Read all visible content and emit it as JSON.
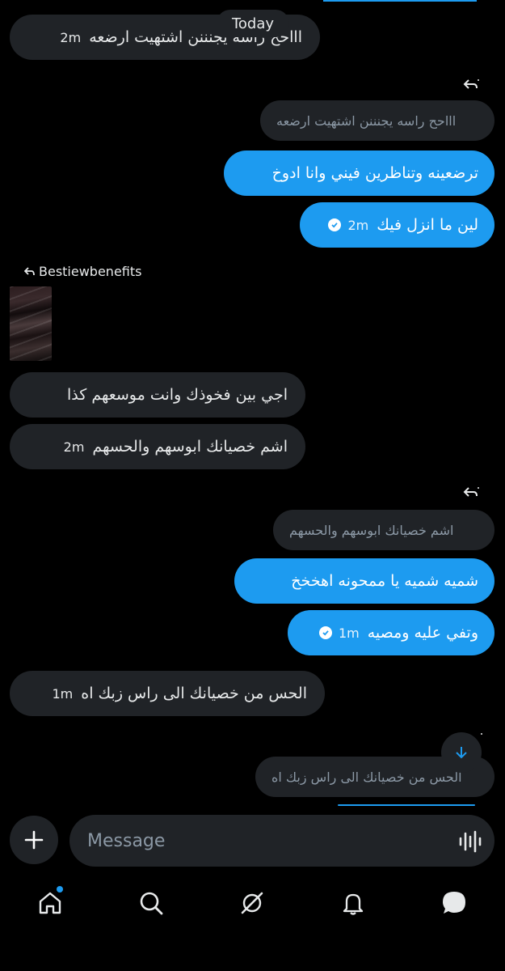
{
  "date_separator": "Today",
  "messages": [
    {
      "text": "اااحح راسه يجنننن اشتهيت ارضعه",
      "time": "2m"
    },
    {
      "quote": "اااحح راسه يجنننن اشتهيت ارضعه"
    },
    {
      "text": "ترضعينه وتناظرين فيني وانا ادوخ"
    },
    {
      "text": "لين ما انزل فيك",
      "time": "2m"
    },
    {
      "replied_to": "Bestiewbenefits"
    },
    {
      "text": "اجي بين فخوذك وانت موسعهم كذا"
    },
    {
      "text": "اشم خصيانك ابوسهم والحسهم",
      "time": "2m"
    },
    {
      "quote": "اشم خصيانك ابوسهم والحسهم"
    },
    {
      "text": "شميه شميه يا ممحونه اهخخخ"
    },
    {
      "text": "وتفي عليه ومصيه",
      "time": "1m"
    },
    {
      "text": "الحس من خصيانك الى راس زبك اه",
      "time": "1m"
    },
    {
      "quote": "الحس من خصيانك الى راس زبك اه"
    }
  ],
  "composer": {
    "placeholder": "Message"
  },
  "nav": {
    "items": [
      "home-icon",
      "search-icon",
      "grok-icon",
      "bell-icon",
      "messages-icon"
    ],
    "home_has_notification": true
  },
  "colors": {
    "accent": "#1d9bf0",
    "incoming": "#202327",
    "background": "#000000"
  }
}
